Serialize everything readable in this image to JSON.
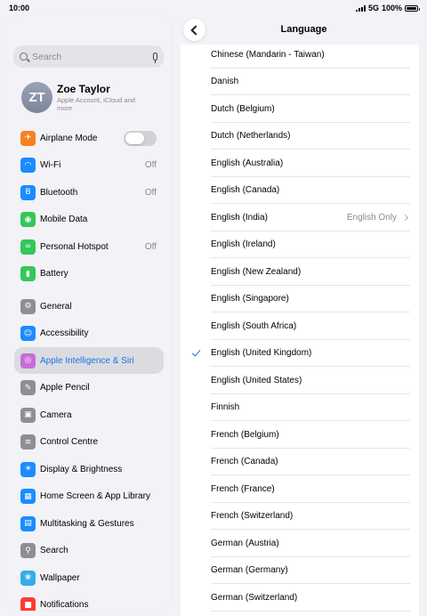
{
  "status_bar": {
    "time": "10:00",
    "network": "5G",
    "battery": "100%"
  },
  "sidebar": {
    "search_placeholder": "Search",
    "profile": {
      "initials": "ZT",
      "name": "Zoe Taylor",
      "subtitle": "Apple Account, iCloud and more"
    },
    "items": [
      {
        "label": "Airplane Mode",
        "icon": "airplane-icon",
        "color": "#f5821f",
        "value": ""
      },
      {
        "label": "Wi-Fi",
        "icon": "wifi-icon",
        "color": "#1a8cff",
        "value": "Off"
      },
      {
        "label": "Bluetooth",
        "icon": "bluetooth-icon",
        "color": "#1a8cff",
        "value": "Off"
      },
      {
        "label": "Mobile Data",
        "icon": "antenna-icon",
        "color": "#34c759",
        "value": ""
      },
      {
        "label": "Personal Hotspot",
        "icon": "hotspot-icon",
        "color": "#34c759",
        "value": "Off"
      },
      {
        "label": "Battery",
        "icon": "battery-icon",
        "color": "#34c759",
        "value": ""
      },
      {
        "label": "General",
        "icon": "gear-icon",
        "color": "#8e8e93",
        "value": ""
      },
      {
        "label": "Accessibility",
        "icon": "accessibility-icon",
        "color": "#1a8cff",
        "value": ""
      },
      {
        "label": "Apple Intelligence & Siri",
        "icon": "siri-icon",
        "color": "#c86dd7",
        "value": ""
      },
      {
        "label": "Apple Pencil",
        "icon": "pencil-icon",
        "color": "#8e8e93",
        "value": ""
      },
      {
        "label": "Camera",
        "icon": "camera-icon",
        "color": "#8e8e93",
        "value": ""
      },
      {
        "label": "Control Centre",
        "icon": "control-centre-icon",
        "color": "#8e8e93",
        "value": ""
      },
      {
        "label": "Display & Brightness",
        "icon": "sun-icon",
        "color": "#1a8cff",
        "value": ""
      },
      {
        "label": "Home Screen & App Library",
        "icon": "home-screen-icon",
        "color": "#1a8cff",
        "value": ""
      },
      {
        "label": "Multitasking & Gestures",
        "icon": "multitasking-icon",
        "color": "#1a8cff",
        "value": ""
      },
      {
        "label": "Search",
        "icon": "search-icon",
        "color": "#8e8e93",
        "value": ""
      },
      {
        "label": "Wallpaper",
        "icon": "wallpaper-icon",
        "color": "#32ade6",
        "value": ""
      },
      {
        "label": "Notifications",
        "icon": "notifications-icon",
        "color": "#ff3b30",
        "value": ""
      }
    ]
  },
  "detail": {
    "title": "Language",
    "languages": [
      {
        "name": "Chinese (Mandarin - Taiwan)",
        "detail": "",
        "checked": false
      },
      {
        "name": "Danish",
        "detail": "",
        "checked": false
      },
      {
        "name": "Dutch (Belgium)",
        "detail": "",
        "checked": false
      },
      {
        "name": "Dutch (Netherlands)",
        "detail": "",
        "checked": false
      },
      {
        "name": "English (Australia)",
        "detail": "",
        "checked": false
      },
      {
        "name": "English (Canada)",
        "detail": "",
        "checked": false
      },
      {
        "name": "English (India)",
        "detail": "English Only",
        "checked": false
      },
      {
        "name": "English (Ireland)",
        "detail": "",
        "checked": false
      },
      {
        "name": "English (New Zealand)",
        "detail": "",
        "checked": false
      },
      {
        "name": "English (Singapore)",
        "detail": "",
        "checked": false
      },
      {
        "name": "English (South Africa)",
        "detail": "",
        "checked": false
      },
      {
        "name": "English (United Kingdom)",
        "detail": "",
        "checked": true
      },
      {
        "name": "English (United States)",
        "detail": "",
        "checked": false
      },
      {
        "name": "Finnish",
        "detail": "",
        "checked": false
      },
      {
        "name": "French (Belgium)",
        "detail": "",
        "checked": false
      },
      {
        "name": "French (Canada)",
        "detail": "",
        "checked": false
      },
      {
        "name": "French (France)",
        "detail": "",
        "checked": false
      },
      {
        "name": "French (Switzerland)",
        "detail": "",
        "checked": false
      },
      {
        "name": "German (Austria)",
        "detail": "",
        "checked": false
      },
      {
        "name": "German (Germany)",
        "detail": "",
        "checked": false
      },
      {
        "name": "German (Switzerland)",
        "detail": "",
        "checked": false
      }
    ]
  }
}
